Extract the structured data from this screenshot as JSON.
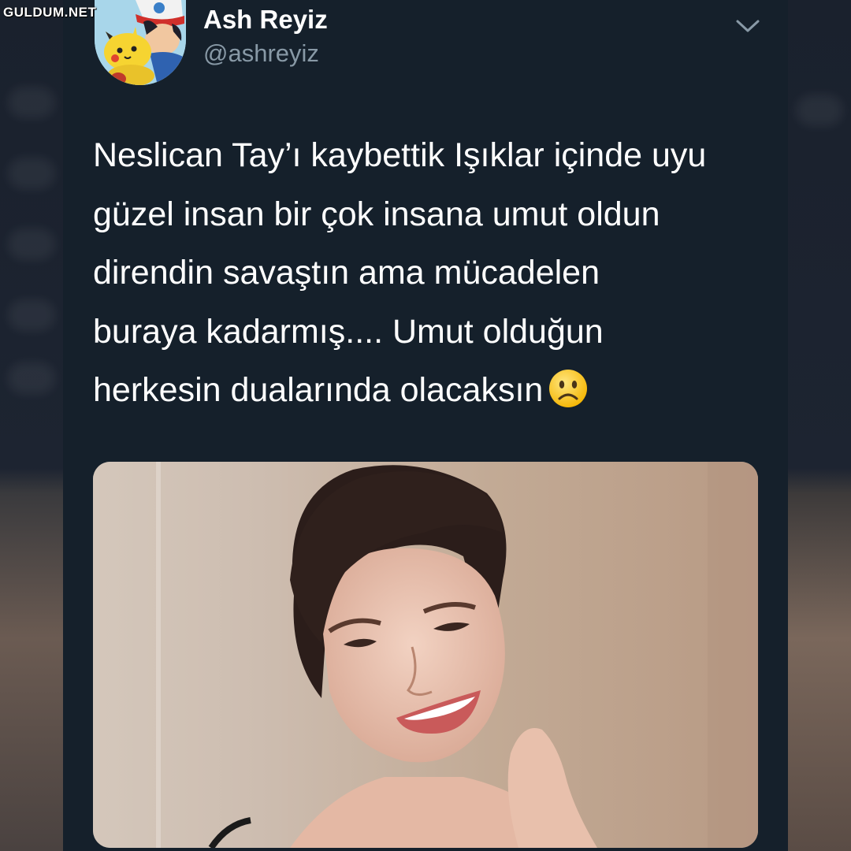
{
  "watermark": "GULDUM.NET",
  "tweet": {
    "display_name": "Ash Reyiz",
    "handle": "@ashreyiz",
    "text": "Neslican Tay’ı kaybettik Işıklar içinde uyu\ngüzel insan bir çok insana umut oldun\ndirendin savaştın ama mücadelen\nburaya kadarmış.... Umut olduğun\nherkesin dualarında olacaksın",
    "emoji": "slightly-frowning-face-emoji",
    "avatar": "pikachu-and-ash-avatar",
    "media": "smiling-woman-portrait-photo"
  },
  "colors": {
    "background": "#15202b",
    "text": "#ffffff",
    "secondary_text": "#8899a6"
  }
}
